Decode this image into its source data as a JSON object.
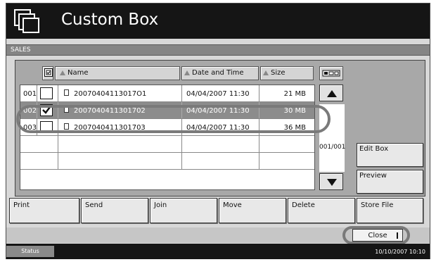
{
  "title": "Custom Box",
  "box_name": "SALES",
  "columns": {
    "name": "Name",
    "date": "Date and Time",
    "size": "Size"
  },
  "rows": [
    {
      "num": "001",
      "name": "20070404113017O1",
      "date": "04/04/2007  11:30",
      "size": "21 MB",
      "checked": false
    },
    {
      "num": "002",
      "name": "2007040411301702",
      "date": "04/04/2007  11:30",
      "size": "30 MB",
      "checked": true
    },
    {
      "num": "003",
      "name": "2007040411301703",
      "date": "04/04/2007  11:30",
      "size": "36 MB",
      "checked": false
    },
    {
      "num": "",
      "name": "",
      "date": "",
      "size": "",
      "checked": false
    },
    {
      "num": "",
      "name": "",
      "date": "",
      "size": "",
      "checked": false
    }
  ],
  "page_indicator": "001/001",
  "side_buttons": {
    "edit_box": "Edit Box",
    "preview": "Preview"
  },
  "actions": {
    "print": "Print",
    "send": "Send",
    "join": "Join",
    "move": "Move",
    "delete": "Delete",
    "store_file": "Store File"
  },
  "close_label": "Close",
  "status": {
    "label": "Status",
    "datetime": "10/10/2007   10:10"
  },
  "colors": {
    "titlebar": "#151515",
    "selected_row": "#8c8c8c",
    "panel": "#a8a8a8"
  }
}
